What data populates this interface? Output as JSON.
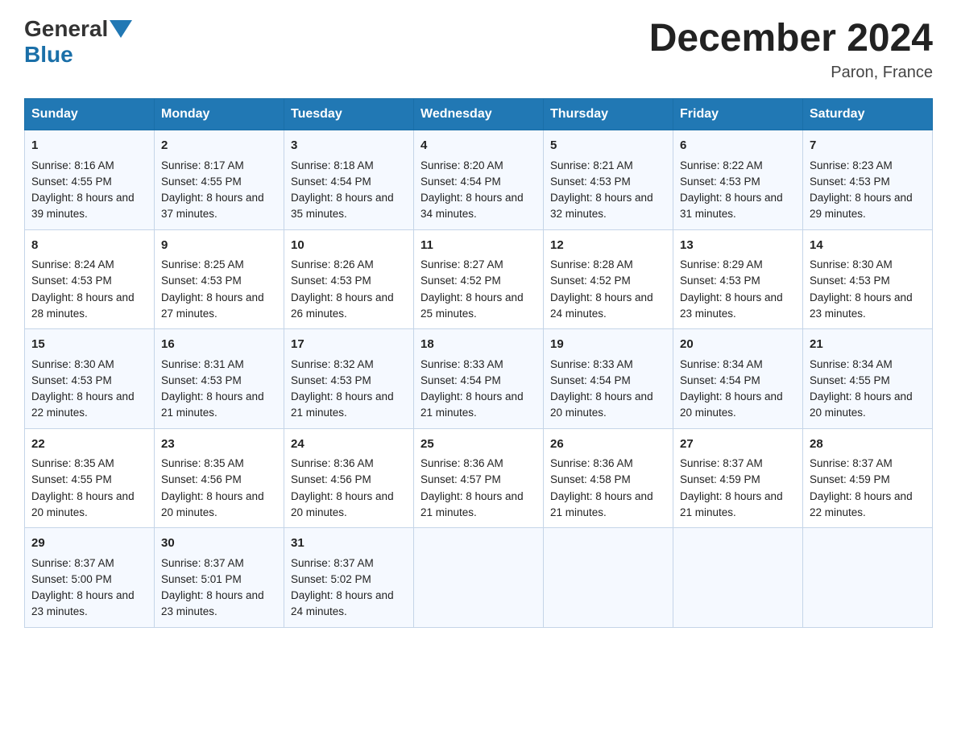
{
  "header": {
    "logo_general": "General",
    "logo_blue": "Blue",
    "title": "December 2024",
    "location": "Paron, France"
  },
  "calendar": {
    "headers": [
      "Sunday",
      "Monday",
      "Tuesday",
      "Wednesday",
      "Thursday",
      "Friday",
      "Saturday"
    ],
    "weeks": [
      [
        {
          "day": "1",
          "sunrise": "8:16 AM",
          "sunset": "4:55 PM",
          "daylight": "8 hours and 39 minutes."
        },
        {
          "day": "2",
          "sunrise": "8:17 AM",
          "sunset": "4:55 PM",
          "daylight": "8 hours and 37 minutes."
        },
        {
          "day": "3",
          "sunrise": "8:18 AM",
          "sunset": "4:54 PM",
          "daylight": "8 hours and 35 minutes."
        },
        {
          "day": "4",
          "sunrise": "8:20 AM",
          "sunset": "4:54 PM",
          "daylight": "8 hours and 34 minutes."
        },
        {
          "day": "5",
          "sunrise": "8:21 AM",
          "sunset": "4:53 PM",
          "daylight": "8 hours and 32 minutes."
        },
        {
          "day": "6",
          "sunrise": "8:22 AM",
          "sunset": "4:53 PM",
          "daylight": "8 hours and 31 minutes."
        },
        {
          "day": "7",
          "sunrise": "8:23 AM",
          "sunset": "4:53 PM",
          "daylight": "8 hours and 29 minutes."
        }
      ],
      [
        {
          "day": "8",
          "sunrise": "8:24 AM",
          "sunset": "4:53 PM",
          "daylight": "8 hours and 28 minutes."
        },
        {
          "day": "9",
          "sunrise": "8:25 AM",
          "sunset": "4:53 PM",
          "daylight": "8 hours and 27 minutes."
        },
        {
          "day": "10",
          "sunrise": "8:26 AM",
          "sunset": "4:53 PM",
          "daylight": "8 hours and 26 minutes."
        },
        {
          "day": "11",
          "sunrise": "8:27 AM",
          "sunset": "4:52 PM",
          "daylight": "8 hours and 25 minutes."
        },
        {
          "day": "12",
          "sunrise": "8:28 AM",
          "sunset": "4:52 PM",
          "daylight": "8 hours and 24 minutes."
        },
        {
          "day": "13",
          "sunrise": "8:29 AM",
          "sunset": "4:53 PM",
          "daylight": "8 hours and 23 minutes."
        },
        {
          "day": "14",
          "sunrise": "8:30 AM",
          "sunset": "4:53 PM",
          "daylight": "8 hours and 23 minutes."
        }
      ],
      [
        {
          "day": "15",
          "sunrise": "8:30 AM",
          "sunset": "4:53 PM",
          "daylight": "8 hours and 22 minutes."
        },
        {
          "day": "16",
          "sunrise": "8:31 AM",
          "sunset": "4:53 PM",
          "daylight": "8 hours and 21 minutes."
        },
        {
          "day": "17",
          "sunrise": "8:32 AM",
          "sunset": "4:53 PM",
          "daylight": "8 hours and 21 minutes."
        },
        {
          "day": "18",
          "sunrise": "8:33 AM",
          "sunset": "4:54 PM",
          "daylight": "8 hours and 21 minutes."
        },
        {
          "day": "19",
          "sunrise": "8:33 AM",
          "sunset": "4:54 PM",
          "daylight": "8 hours and 20 minutes."
        },
        {
          "day": "20",
          "sunrise": "8:34 AM",
          "sunset": "4:54 PM",
          "daylight": "8 hours and 20 minutes."
        },
        {
          "day": "21",
          "sunrise": "8:34 AM",
          "sunset": "4:55 PM",
          "daylight": "8 hours and 20 minutes."
        }
      ],
      [
        {
          "day": "22",
          "sunrise": "8:35 AM",
          "sunset": "4:55 PM",
          "daylight": "8 hours and 20 minutes."
        },
        {
          "day": "23",
          "sunrise": "8:35 AM",
          "sunset": "4:56 PM",
          "daylight": "8 hours and 20 minutes."
        },
        {
          "day": "24",
          "sunrise": "8:36 AM",
          "sunset": "4:56 PM",
          "daylight": "8 hours and 20 minutes."
        },
        {
          "day": "25",
          "sunrise": "8:36 AM",
          "sunset": "4:57 PM",
          "daylight": "8 hours and 21 minutes."
        },
        {
          "day": "26",
          "sunrise": "8:36 AM",
          "sunset": "4:58 PM",
          "daylight": "8 hours and 21 minutes."
        },
        {
          "day": "27",
          "sunrise": "8:37 AM",
          "sunset": "4:59 PM",
          "daylight": "8 hours and 21 minutes."
        },
        {
          "day": "28",
          "sunrise": "8:37 AM",
          "sunset": "4:59 PM",
          "daylight": "8 hours and 22 minutes."
        }
      ],
      [
        {
          "day": "29",
          "sunrise": "8:37 AM",
          "sunset": "5:00 PM",
          "daylight": "8 hours and 23 minutes."
        },
        {
          "day": "30",
          "sunrise": "8:37 AM",
          "sunset": "5:01 PM",
          "daylight": "8 hours and 23 minutes."
        },
        {
          "day": "31",
          "sunrise": "8:37 AM",
          "sunset": "5:02 PM",
          "daylight": "8 hours and 24 minutes."
        },
        null,
        null,
        null,
        null
      ]
    ]
  }
}
